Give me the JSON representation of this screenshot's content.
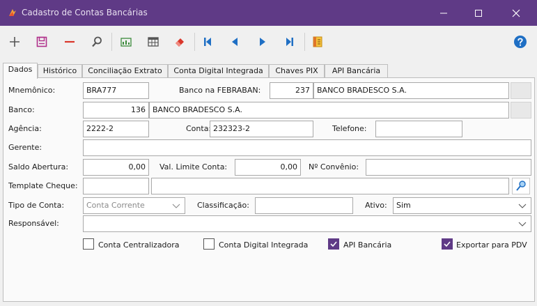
{
  "window": {
    "title": "Cadastro de Contas Bancárias"
  },
  "tabs": [
    "Dados",
    "Histórico",
    "Conciliação Extrato",
    "Conta Digital Integrada",
    "Chaves PIX",
    "API Bancária"
  ],
  "form": {
    "mnemonico": {
      "label": "Mnemônico:",
      "value": "BRA777"
    },
    "banco_febraban": {
      "label": "Banco na FEBRABAN:",
      "code": "237",
      "name": "BANCO BRADESCO S.A."
    },
    "banco": {
      "label": "Banco:",
      "code": "136",
      "name": "BANCO BRADESCO S.A."
    },
    "agencia": {
      "label": "Agência:",
      "value": "2222-2"
    },
    "conta": {
      "label": "Conta:",
      "value": "232323-2"
    },
    "telefone": {
      "label": "Telefone:",
      "value": ""
    },
    "gerente": {
      "label": "Gerente:",
      "value": ""
    },
    "saldo_abertura": {
      "label": "Saldo Abertura:",
      "value": "0,00"
    },
    "val_limite_conta": {
      "label": "Val. Limite Conta:",
      "value": "0,00"
    },
    "nro_convenio": {
      "label": "Nº Convênio:",
      "value": ""
    },
    "template_cheque": {
      "label": "Template Cheque:",
      "code": "",
      "name": ""
    },
    "tipo_conta": {
      "label": "Tipo de Conta:",
      "value": "Conta Corrente"
    },
    "classificacao": {
      "label": "Classificação:",
      "value": ""
    },
    "ativo": {
      "label": "Ativo:",
      "value": "Sim"
    },
    "responsavel": {
      "label": "Responsável:",
      "value": ""
    }
  },
  "checkboxes": {
    "conta_centralizadora": {
      "label": "Conta Centralizadora",
      "checked": false
    },
    "conta_digital_integrada": {
      "label": "Conta Digital Integrada",
      "checked": false
    },
    "api_bancaria": {
      "label": "API Bancária",
      "checked": true
    },
    "exportar_pdv": {
      "label": "Exportar para PDV",
      "checked": true
    }
  },
  "colors": {
    "titlebar": "#5f3a86",
    "accent": "#5f3a86",
    "toolbar_blue": "#1f6fc4",
    "toolbar_red": "#d9362b",
    "help_blue": "#1f6fc4"
  },
  "icons": [
    "add-icon",
    "save-icon",
    "delete-icon",
    "search-icon",
    "report-icon",
    "grid-icon",
    "eraser-icon",
    "first-record-icon",
    "previous-record-icon",
    "next-record-icon",
    "last-record-icon",
    "notes-icon",
    "help-icon"
  ]
}
